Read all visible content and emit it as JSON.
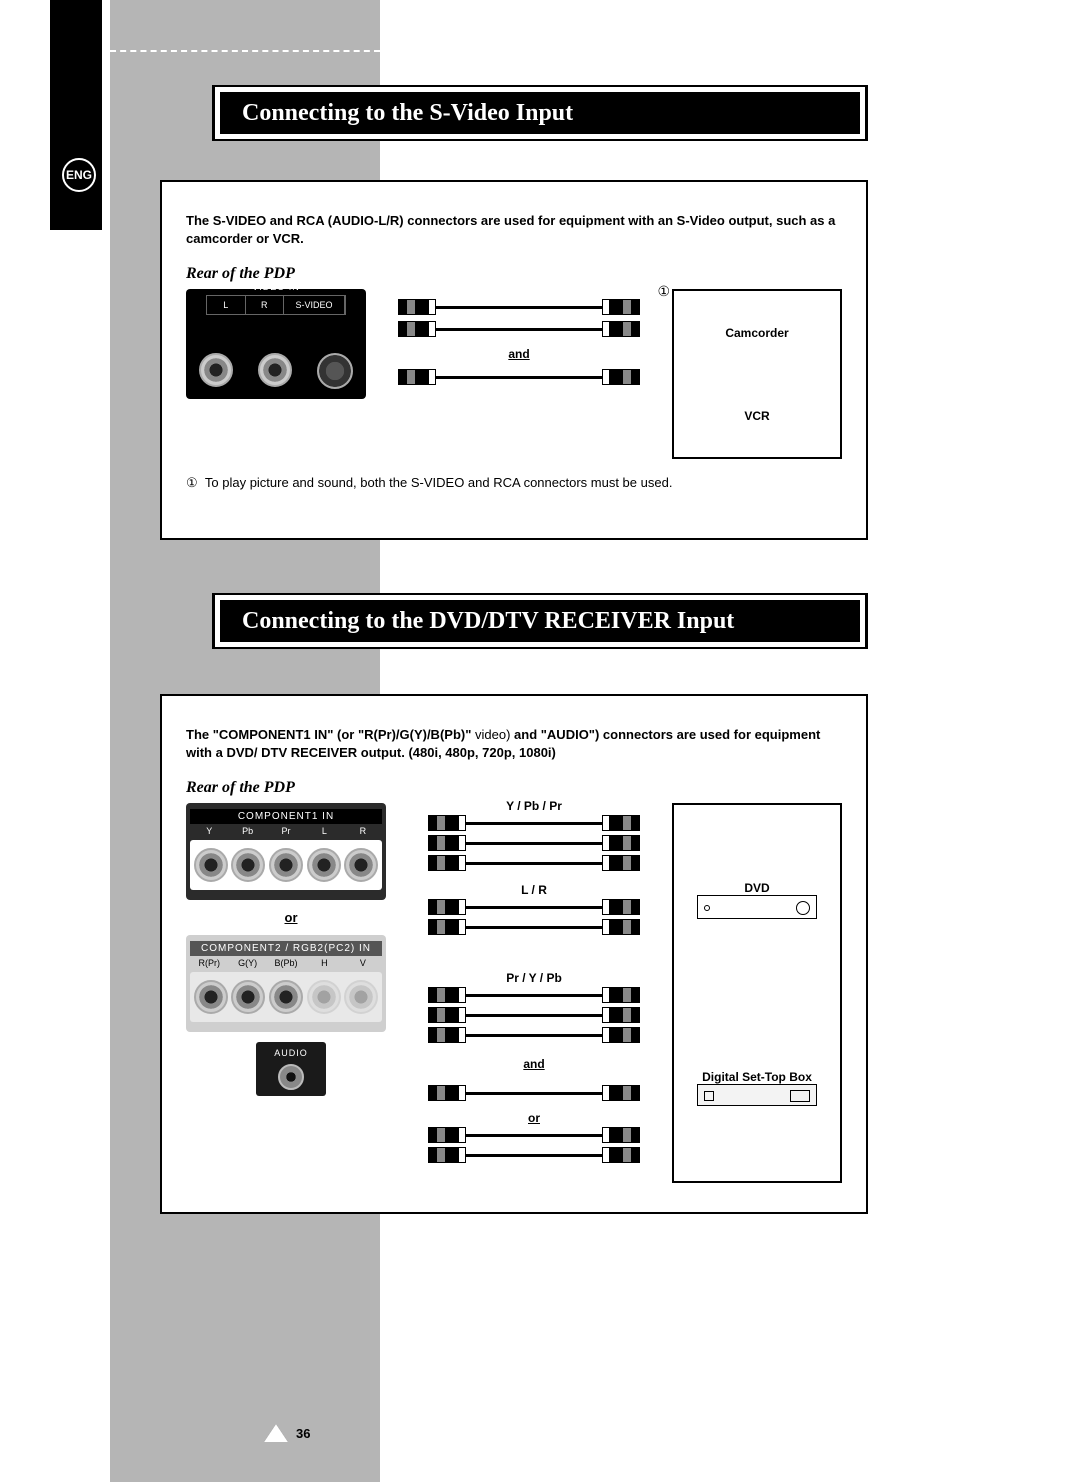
{
  "language_badge": "ENG",
  "page_number": "36",
  "section1": {
    "title": "Connecting to the S-Video Input",
    "intro_bold_1": "The S-VIDEO and RCA (AUDIO-L/R) connectors are used for equipment with an S-Video output, such as a camcorder or VCR.",
    "rear_label": "Rear of the PDP",
    "panel_header": "VIDEO IN",
    "panel_labels": {
      "l": "L",
      "r": "R",
      "svideo": "S-VIDEO"
    },
    "cable_marker": "①",
    "and_label": "and",
    "devices": {
      "camcorder": "Camcorder",
      "vcr": "VCR"
    },
    "footnote_marker": "①",
    "footnote": "To play picture and sound, both the S-VIDEO and RCA connectors must be used."
  },
  "section2": {
    "title": "Connecting to the DVD/DTV RECEIVER Input",
    "intro_part1_bold": "The \"COMPONENT1 IN\" (or",
    "intro_part2_bold": " \"R(Pr)/G(Y)/B(Pb)\"",
    "intro_part3_normal": " video)",
    "intro_part4_bold": " and \"AUDIO\") connectors are used for equipment with a DVD/ DTV RECEIVER output. (480i, 480p, 720p, 1080i)",
    "rear_label": "Rear of the PDP",
    "comp1_header": "COMPONENT1 IN",
    "comp1_labels": [
      "Y",
      "Pb",
      "Pr",
      "L",
      "R"
    ],
    "comp2_header": "COMPONENT2 / RGB2(PC2) IN",
    "comp2_labels": [
      "R(Pr)",
      "G(Y)",
      "B(Pb)",
      "H",
      "V"
    ],
    "audio_header": "AUDIO",
    "or_label": "or",
    "cable_labels": {
      "ypbpr": "Y / Pb / Pr",
      "lr": "L / R",
      "prypb": "Pr / Y / Pb",
      "and": "and",
      "or": "or"
    },
    "devices": {
      "dvd": "DVD",
      "stb": "Digital Set-Top Box"
    }
  }
}
